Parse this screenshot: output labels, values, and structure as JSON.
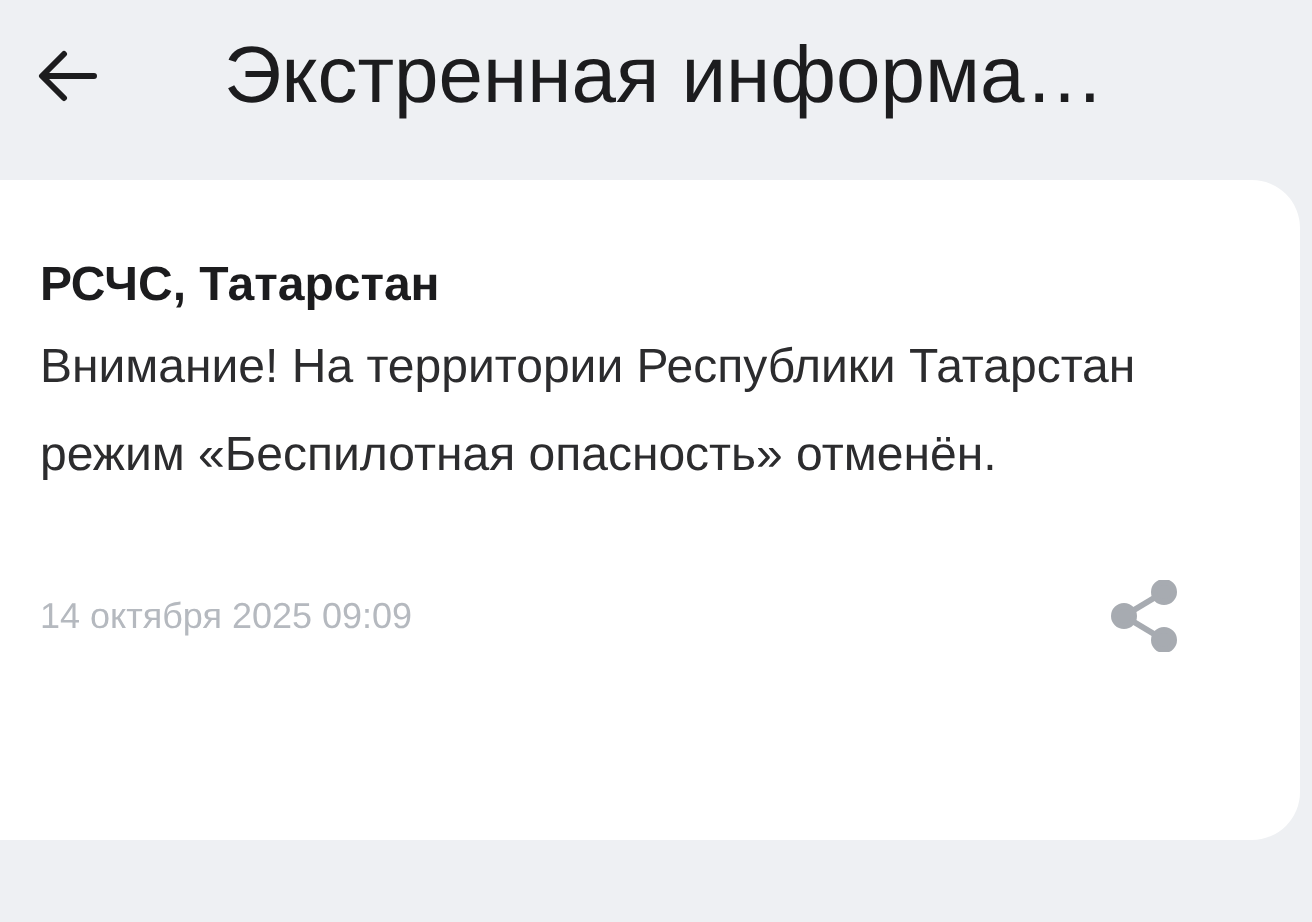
{
  "header": {
    "title": "Экстренная информа…"
  },
  "message": {
    "sender": "РСЧС, Татарстан",
    "text": "Внимание! На территории Республики Татарстан режим «Беспилотная опасность» отменён.",
    "date": "14 октября 2025 09:09"
  }
}
